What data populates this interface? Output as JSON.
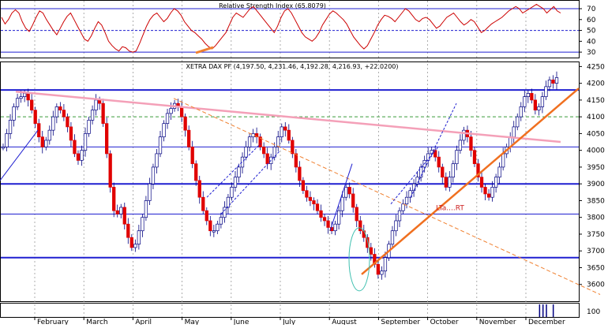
{
  "chart_data": [
    {
      "type": "line",
      "title": "Relative Strength Index (65.8079)",
      "ylim": [
        25,
        78
      ],
      "yticks": [
        30,
        40,
        50,
        60,
        70
      ],
      "levels": [
        30,
        50,
        70
      ],
      "series": [
        {
          "values": [
            62,
            56,
            60,
            66,
            69,
            66,
            58,
            52,
            49,
            55,
            62,
            68,
            66,
            60,
            55,
            50,
            46,
            52,
            58,
            63,
            66,
            60,
            54,
            48,
            42,
            40,
            45,
            52,
            58,
            55,
            48,
            40,
            36,
            33,
            31,
            35,
            34,
            31,
            30,
            31,
            38,
            46,
            54,
            60,
            64,
            66,
            62,
            58,
            61,
            66,
            70,
            68,
            64,
            58,
            54,
            50,
            48,
            45,
            42,
            38,
            35,
            33,
            36,
            40,
            44,
            48,
            55,
            62,
            66,
            64,
            62,
            66,
            70,
            72,
            68,
            64,
            60,
            56,
            52,
            48,
            54,
            62,
            68,
            70,
            66,
            60,
            54,
            48,
            44,
            42,
            40,
            43,
            48,
            55,
            60,
            65,
            68,
            66,
            63,
            60,
            56,
            50,
            44,
            40,
            36,
            33,
            36,
            42,
            48,
            55,
            60,
            64,
            63,
            61,
            58,
            62,
            66,
            70,
            68,
            64,
            60,
            58,
            61,
            62,
            60,
            56,
            52,
            54,
            58,
            62,
            64,
            66,
            62,
            58,
            55,
            57,
            60,
            58,
            53,
            48,
            50,
            53,
            56,
            58,
            60,
            62,
            65,
            68,
            70,
            72,
            70,
            66,
            68,
            70,
            72,
            74,
            72,
            70,
            66,
            69,
            72,
            68,
            66
          ]
        }
      ]
    },
    {
      "type": "candlestick",
      "title": "XETRA DAX PF (4,197.50, 4,231.46, 4,192.28, 4,216.93, +22.0200)",
      "ylim": [
        3550,
        4265
      ],
      "yticks": [
        3600,
        3650,
        3700,
        3750,
        3800,
        3850,
        3900,
        3950,
        4000,
        4050,
        4100,
        4150,
        4200,
        4250
      ],
      "x_months": [
        "February",
        "March",
        "April",
        "May",
        "June",
        "July",
        "August",
        "September",
        "October",
        "November",
        "December"
      ],
      "levels": [
        4180,
        4100,
        4010,
        3900,
        3810,
        3680
      ],
      "closes": [
        4010,
        4050,
        4090,
        4130,
        4155,
        4160,
        4170,
        4150,
        4120,
        4080,
        4040,
        4010,
        4030,
        4060,
        4100,
        4130,
        4120,
        4100,
        4070,
        4030,
        3990,
        3970,
        4000,
        4050,
        4090,
        4120,
        4150,
        4140,
        4080,
        3990,
        3890,
        3820,
        3810,
        3830,
        3780,
        3740,
        3710,
        3720,
        3760,
        3800,
        3850,
        3900,
        3950,
        3990,
        4040,
        4080,
        4110,
        4125,
        4140,
        4130,
        4100,
        4060,
        4010,
        3960,
        3910,
        3860,
        3820,
        3790,
        3760,
        3760,
        3780,
        3800,
        3830,
        3860,
        3890,
        3920,
        3950,
        3980,
        4010,
        4040,
        4050,
        4040,
        4010,
        3990,
        3960,
        3980,
        4010,
        4040,
        4070,
        4060,
        4030,
        3990,
        3950,
        3910,
        3880,
        3860,
        3850,
        3840,
        3820,
        3800,
        3790,
        3770,
        3760,
        3780,
        3820,
        3860,
        3890,
        3870,
        3830,
        3790,
        3760,
        3740,
        3710,
        3690,
        3660,
        3630,
        3640,
        3680,
        3720,
        3760,
        3790,
        3820,
        3840,
        3860,
        3880,
        3900,
        3920,
        3950,
        3970,
        3990,
        4000,
        3980,
        3950,
        3920,
        3890,
        3920,
        3960,
        4000,
        4030,
        4060,
        4040,
        4000,
        3960,
        3920,
        3890,
        3870,
        3860,
        3890,
        3920,
        3950,
        3990,
        4010,
        4040,
        4070,
        4100,
        4130,
        4160,
        4170,
        4150,
        4120,
        4130,
        4160,
        4190,
        4210,
        4200,
        4217
      ]
    },
    {
      "type": "bar",
      "title": "",
      "yticks": [
        100
      ],
      "values": [
        0,
        0,
        0,
        0,
        0,
        0,
        0,
        0,
        0,
        0,
        0,
        0,
        0,
        0,
        0,
        0,
        0,
        0,
        0,
        0,
        0,
        0,
        0,
        0,
        0,
        0,
        0,
        0,
        0,
        0,
        0,
        0,
        0,
        0,
        0,
        0,
        0,
        0,
        0,
        0,
        0,
        0,
        0,
        0,
        0,
        0,
        0,
        0,
        0,
        0,
        0,
        0,
        0,
        0,
        0,
        0,
        0,
        0,
        0,
        0,
        0,
        0,
        0,
        0,
        0,
        0,
        0,
        0,
        0,
        0,
        0,
        0,
        0,
        0,
        0,
        0,
        0,
        0,
        0,
        0,
        0,
        0,
        0,
        0,
        0,
        0,
        0,
        0,
        0,
        0,
        0,
        0,
        0,
        0,
        0,
        0,
        0,
        0,
        0,
        0,
        0,
        0,
        0,
        0,
        0,
        0,
        0,
        0,
        0,
        0,
        0,
        0,
        0,
        0,
        0,
        0,
        0,
        0,
        0,
        0,
        0,
        0,
        0,
        0,
        0,
        0,
        0,
        0,
        0,
        0,
        0,
        0,
        0,
        0,
        0,
        0,
        0,
        0,
        0,
        0,
        0,
        0,
        0,
        0,
        0,
        0,
        0,
        0,
        0,
        0,
        0,
        0,
        0,
        0,
        0,
        0,
        0,
        1,
        1,
        1,
        0,
        1,
        0
      ]
    }
  ],
  "annotations": {
    "trend_label": "LTa....RT"
  }
}
